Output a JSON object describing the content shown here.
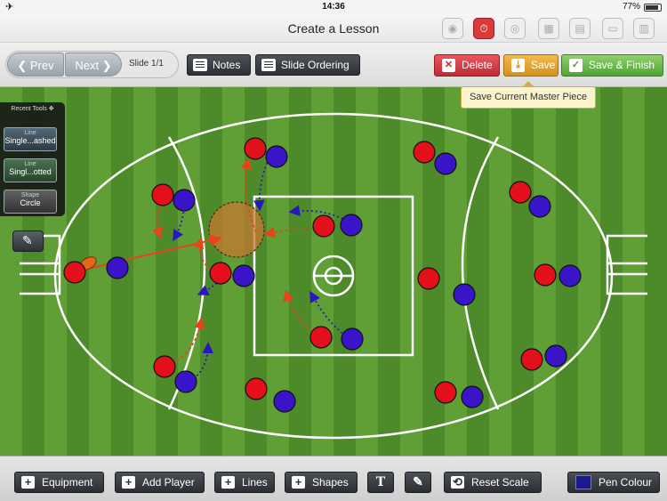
{
  "status": {
    "time": "14:36",
    "battery": "77%"
  },
  "titlebar": {
    "title": "Create a Lesson"
  },
  "toolbar": {
    "prev": "Prev",
    "next": "Next",
    "slide": "Slide 1/1",
    "notes": "Notes",
    "slide_ordering": "Slide Ordering",
    "delete": "Delete",
    "save": "Save",
    "save_finish": "Save & Finish"
  },
  "tooltip": "Save Current Master Piece",
  "recent_tools": {
    "title": "Recent Tools",
    "items": [
      {
        "kind": "Line",
        "value": "Single...ashed"
      },
      {
        "kind": "Line",
        "value": "Singl...otted"
      },
      {
        "kind": "Shape",
        "value": "Circle"
      }
    ]
  },
  "bottom": {
    "equipment": "Equipment",
    "add_player": "Add Player",
    "lines": "Lines",
    "shapes": "Shapes",
    "text_tool": "T",
    "reset_scale": "Reset Scale",
    "pen_colour": "Pen Colour"
  },
  "colors": {
    "red_team": "#e3101c",
    "blue_team": "#3a14c8",
    "pen": "#1c1a8c",
    "zone": "#b0702a"
  }
}
